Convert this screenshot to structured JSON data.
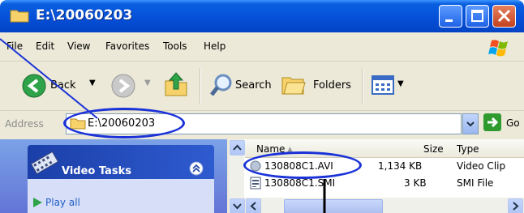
{
  "window": {
    "title": "E:\\20060203"
  },
  "menu": {
    "file": "File",
    "edit": "Edit",
    "view": "View",
    "favorites": "Favorites",
    "tools": "Tools",
    "help": "Help"
  },
  "toolbar": {
    "back": "Back",
    "search": "Search",
    "folders": "Folders"
  },
  "address": {
    "label": "Address",
    "value": "E:\\20060203",
    "go": "Go"
  },
  "task_pane": {
    "title": "Video Tasks",
    "items": [
      "Play all"
    ]
  },
  "file_list": {
    "columns": {
      "name": "Name",
      "size": "Size",
      "type": "Type"
    },
    "rows": [
      {
        "name": "130808C1.AVI",
        "size": "1,134 KB",
        "type": "Video Clip"
      },
      {
        "name": "130808C1.SMI",
        "size": "3 KB",
        "type": "SMI File"
      }
    ]
  },
  "colors": {
    "title_bar": "#0550d8",
    "annotation": "#1a32d8",
    "task_pane": "#6d8de0"
  }
}
